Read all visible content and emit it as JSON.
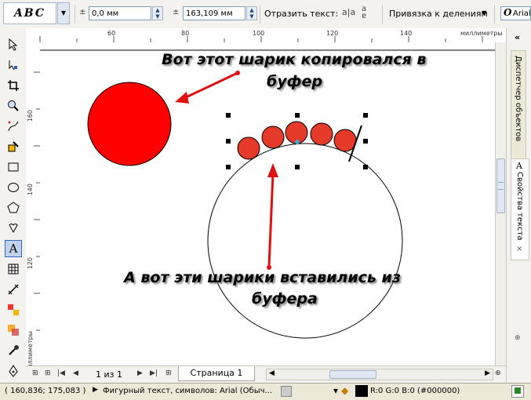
{
  "propbar": {
    "artistic_text_label": "ABC",
    "field_x": "0,0 мм",
    "field_y": "163,109 мм",
    "mirror_text_label": "Отразить текст:",
    "snap_label": "Привязка к делениям",
    "font_name": "Arial"
  },
  "ruler": {
    "h_ticks": [
      "60",
      "80",
      "100",
      "120",
      "140"
    ],
    "h_unit": "миллиметры",
    "v_ticks": [
      "160",
      "140",
      "120"
    ],
    "v_unit": "миллиметры"
  },
  "annotations": {
    "top": [
      "Вот этот шарик копировался в",
      "буфер"
    ],
    "bottom": [
      "А вот эти шарики вставились из",
      "буфера"
    ]
  },
  "docker": {
    "tab1": "Диспетчер объектов",
    "tab2": "Свойства текста"
  },
  "nav": {
    "page_count": "1 из 1",
    "page_tab": "Страница 1"
  },
  "status": {
    "coords": "( 160,836; 175,083 )",
    "info": "Фигурный текст, символов: Arial (Обыч...",
    "color_value": "R:0 G:0 B:0 (#000000)"
  },
  "colors": {
    "ball_red": "#ff0000",
    "ball_small": "#e53a2a",
    "arrow_red": "#e01010",
    "selection": "#1f5fbf"
  }
}
